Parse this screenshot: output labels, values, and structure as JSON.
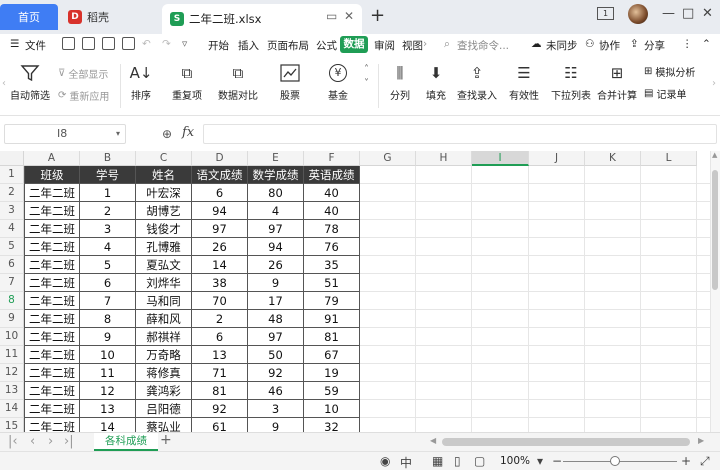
{
  "tabs": {
    "home": "首页",
    "docer": "稻壳",
    "file": "二年二班.xlsx",
    "window_num": "1"
  },
  "menu": {
    "file": "文件",
    "items": [
      "开始",
      "插入",
      "页面布局",
      "公式",
      "数据",
      "审阅",
      "视图"
    ],
    "search": "查找命令...",
    "sync": "未同步",
    "collab": "协作",
    "share": "分享"
  },
  "ribbon": {
    "autofilter": "自动筛选",
    "show_all": "全部显示",
    "reapply": "重新应用",
    "sort": "排序",
    "duplicates": "重复项",
    "compare": "数据对比",
    "stocks": "股票",
    "funds": "基金",
    "split": "分列",
    "fill": "填充",
    "lookup": "查找录入",
    "validity": "有效性",
    "dropdown": "下拉列表",
    "consolidate": "合并计算",
    "whatif": "模拟分析",
    "form": "记录单"
  },
  "formula": {
    "name_box": "I8",
    "fx": "fx"
  },
  "grid": {
    "columns": [
      "A",
      "B",
      "C",
      "D",
      "E",
      "F",
      "G",
      "H",
      "I",
      "J",
      "K",
      "L"
    ],
    "rows": [
      "1",
      "2",
      "3",
      "4",
      "5",
      "6",
      "7",
      "8",
      "9",
      "10",
      "11",
      "12",
      "13",
      "14",
      "15"
    ],
    "headers": [
      "班级",
      "学号",
      "姓名",
      "语文成绩",
      "数学成绩",
      "英语成绩"
    ],
    "data": [
      [
        "二年二班",
        "1",
        "叶宏深",
        "6",
        "80",
        "40"
      ],
      [
        "二年二班",
        "2",
        "胡博艺",
        "94",
        "4",
        "40"
      ],
      [
        "二年二班",
        "3",
        "钱俊才",
        "97",
        "97",
        "78"
      ],
      [
        "二年二班",
        "4",
        "孔博雅",
        "26",
        "94",
        "76"
      ],
      [
        "二年二班",
        "5",
        "夏弘文",
        "14",
        "26",
        "35"
      ],
      [
        "二年二班",
        "6",
        "刘烨华",
        "38",
        "9",
        "51"
      ],
      [
        "二年二班",
        "7",
        "马和同",
        "70",
        "17",
        "79"
      ],
      [
        "二年二班",
        "8",
        "薛和风",
        "2",
        "48",
        "91"
      ],
      [
        "二年二班",
        "9",
        "郝祺祥",
        "6",
        "97",
        "81"
      ],
      [
        "二年二班",
        "10",
        "万奇略",
        "13",
        "50",
        "67"
      ],
      [
        "二年二班",
        "11",
        "蒋修真",
        "71",
        "92",
        "19"
      ],
      [
        "二年二班",
        "12",
        "龚鸿彩",
        "81",
        "46",
        "59"
      ],
      [
        "二年二班",
        "13",
        "吕阳德",
        "92",
        "3",
        "10"
      ],
      [
        "二年二班",
        "14",
        "蔡弘业",
        "61",
        "9",
        "32"
      ]
    ],
    "active_col": "I",
    "active_row": "8"
  },
  "sheets": {
    "active": "各科成绩"
  },
  "status": {
    "zoom": "100%"
  },
  "colors": {
    "accent": "#1f9d55",
    "home_tab": "#3f7df4",
    "header_fill": "#3a3a3a"
  }
}
